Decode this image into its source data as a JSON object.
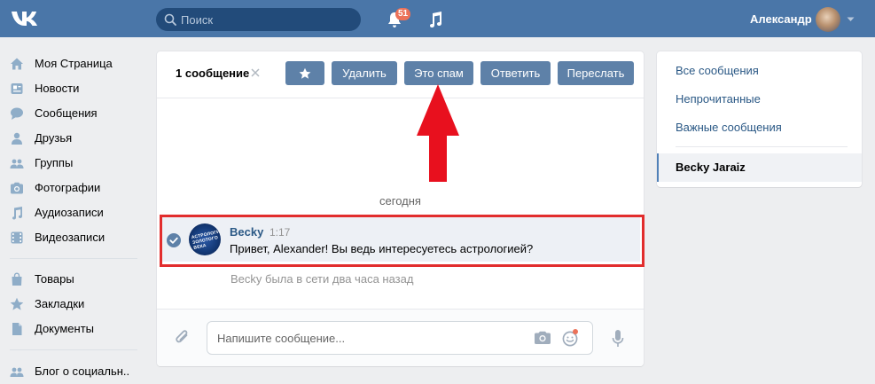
{
  "topbar": {
    "search_placeholder": "Поиск",
    "notifications_count": "51",
    "user_name": "Александр"
  },
  "sidebar": {
    "items": [
      {
        "label": "Моя Страница",
        "icon": "home-icon"
      },
      {
        "label": "Новости",
        "icon": "news-icon"
      },
      {
        "label": "Сообщения",
        "icon": "messages-icon"
      },
      {
        "label": "Друзья",
        "icon": "friends-icon"
      },
      {
        "label": "Группы",
        "icon": "groups-icon"
      },
      {
        "label": "Фотографии",
        "icon": "camera-icon"
      },
      {
        "label": "Аудиозаписи",
        "icon": "music-icon"
      },
      {
        "label": "Видеозаписи",
        "icon": "video-icon"
      },
      {
        "label": "Товары",
        "icon": "bag-icon"
      },
      {
        "label": "Закладки",
        "icon": "star-icon"
      },
      {
        "label": "Документы",
        "icon": "document-icon"
      },
      {
        "label": "Блог о социальн..",
        "icon": "group-icon"
      }
    ]
  },
  "toolbar": {
    "selected_count": "1 сообщение",
    "delete_label": "Удалить",
    "spam_label": "Это спам",
    "reply_label": "Ответить",
    "forward_label": "Переслать"
  },
  "conversation": {
    "date_label": "сегодня",
    "message": {
      "author": "Becky",
      "time": "1:17",
      "text": "Привет, Alexander! Вы ведь интересуетесь астрологией?",
      "avatar_text": "АСТРОЛОГИЯ ЗОЛОТОГО ВЕКА"
    },
    "last_seen": "Becky была в сети два часа назад",
    "input_placeholder": "Напишите сообщение..."
  },
  "right_panel": {
    "items": [
      "Все сообщения",
      "Непрочитанные",
      "Важные сообщения"
    ],
    "active_dialog": "Becky Jaraiz"
  },
  "colors": {
    "header_bg": "#4a76a8",
    "button_bg": "#5e81a8",
    "link": "#2a5885",
    "highlight": "#e22d2d"
  }
}
